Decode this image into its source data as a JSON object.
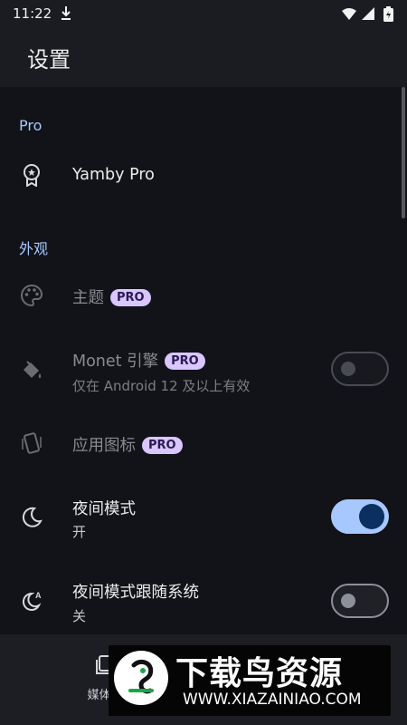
{
  "status_bar": {
    "time": "11:22"
  },
  "app_bar": {
    "title": "设置"
  },
  "sections": {
    "pro": {
      "header": "Pro"
    },
    "appearance": {
      "header": "外观"
    }
  },
  "settings": {
    "yamby_pro": {
      "title": "Yamby Pro"
    },
    "theme": {
      "title": "主题",
      "badge": "PRO"
    },
    "monet": {
      "title": "Monet 引擎",
      "badge": "PRO",
      "subtitle": "仅在 Android 12 及以上有效",
      "enabled": false
    },
    "app_icon": {
      "title": "应用图标",
      "badge": "PRO"
    },
    "night_mode": {
      "title": "夜间模式",
      "subtitle": "开",
      "enabled": true
    },
    "night_follow_system": {
      "title": "夜间模式跟随系统",
      "subtitle": "关",
      "enabled": false
    }
  },
  "bottom_nav": {
    "media_label": "媒体库"
  },
  "watermark": {
    "text": "下载鸟资源",
    "url": "WWW.XIAZAINIAO.COM"
  },
  "colors": {
    "accent": "#a7c8ff",
    "badge_bg": "#d9c6ff",
    "background": "#111318",
    "bar": "#1a1c21"
  },
  "icons": [
    "download-icon",
    "wifi-icon",
    "signal-icon",
    "battery-icon",
    "badge-icon",
    "palette-icon",
    "paint-bucket-icon",
    "app-icon-icon",
    "moon-icon",
    "moon-auto-icon",
    "media-library-icon"
  ]
}
